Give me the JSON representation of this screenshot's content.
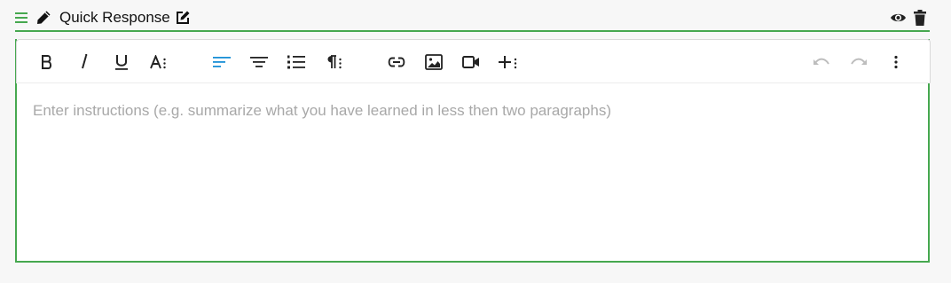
{
  "header": {
    "title": "Quick Response",
    "accent_color": "#46a84f",
    "icons": [
      "drag-handle-icon",
      "pencil-icon",
      "edit-icon",
      "eye-icon",
      "trash-icon"
    ]
  },
  "toolbar": {
    "buttons": [
      {
        "name": "bold",
        "glyph": "B"
      },
      {
        "name": "italic",
        "glyph": "i"
      },
      {
        "name": "underline",
        "glyph": "U"
      },
      {
        "name": "font-size"
      },
      {
        "name": "align-left",
        "active": true
      },
      {
        "name": "align-center"
      },
      {
        "name": "ordered-list"
      },
      {
        "name": "paragraph-format"
      },
      {
        "name": "insert-link"
      },
      {
        "name": "insert-image"
      },
      {
        "name": "insert-video"
      },
      {
        "name": "insert-more"
      },
      {
        "name": "undo",
        "disabled": true
      },
      {
        "name": "redo",
        "disabled": true
      },
      {
        "name": "more-options"
      }
    ],
    "active_color": "#1a8fd6"
  },
  "editor": {
    "placeholder": "Enter instructions (e.g. summarize what you have learned in less then two paragraphs)"
  }
}
